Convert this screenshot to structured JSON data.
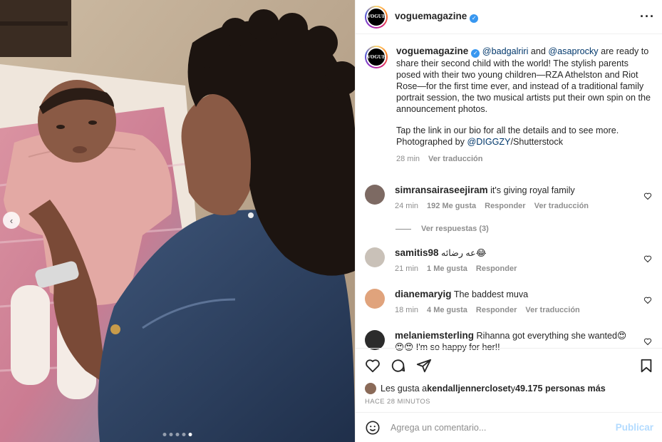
{
  "post": {
    "author": "voguemagazine",
    "avatar_text": "VOGUE",
    "more_icon": "more-options-icon",
    "verified_icon": "verified-badge-icon"
  },
  "caption": {
    "author": "voguemagazine",
    "mention_1": "@badgalriri",
    "and": " and ",
    "mention_2": "@asaprocky",
    "text_1": " are ready to share their second child with the world! The stylish parents posed with their two young children—RZA Athelston and Riot Rose—for the first time ever, and instead of a traditional family portrait session, the two musical artists put their own spin on the announcement photos.",
    "text_2_prefix": "Tap the link in our bio for all the details and to see more. Photographed by ",
    "mention_3": "@DIGGZY",
    "text_2_suffix": "/Shutterstock",
    "time": "28 min",
    "translate": "Ver traducción"
  },
  "comments": [
    {
      "user": "simransairaseejiram",
      "text": "it's giving royal family",
      "time": "24 min",
      "likes": "192 Me gusta",
      "reply": "Responder",
      "translate": "Ver traducción",
      "avatar_color": "#7d6a63"
    },
    {
      "user": "samitis98",
      "text": "عه رضائه😂",
      "time": "21 min",
      "likes": "1 Me gusta",
      "reply": "Responder",
      "avatar_color": "#c9c1b8"
    },
    {
      "user": "dianemaryig",
      "text": "The baddest muva",
      "time": "18 min",
      "likes": "4 Me gusta",
      "reply": "Responder",
      "translate": "Ver traducción",
      "avatar_color": "#e0a37c"
    },
    {
      "user": "melaniemsterling",
      "text": "Rihanna got everything she wanted😍😍😍 I'm so happy for her!!",
      "avatar_color": "#2b2b2b"
    }
  ],
  "view_replies": "Ver respuestas (3)",
  "likes_line": {
    "prefix": "Les gusta a ",
    "user": "kendalljennercloset",
    "middle": " y ",
    "count": "49.175 personas más"
  },
  "time_ago": "HACE 28 MINUTOS",
  "add_comment": {
    "placeholder": "Agrega un comentario...",
    "publish": "Publicar"
  },
  "carousel": {
    "dots": 5,
    "active_index": 4
  },
  "colors": {
    "link": "#00376b",
    "verified": "#3897f0",
    "publish_disabled": "#b3dbff",
    "muted": "#8e8e8e"
  }
}
